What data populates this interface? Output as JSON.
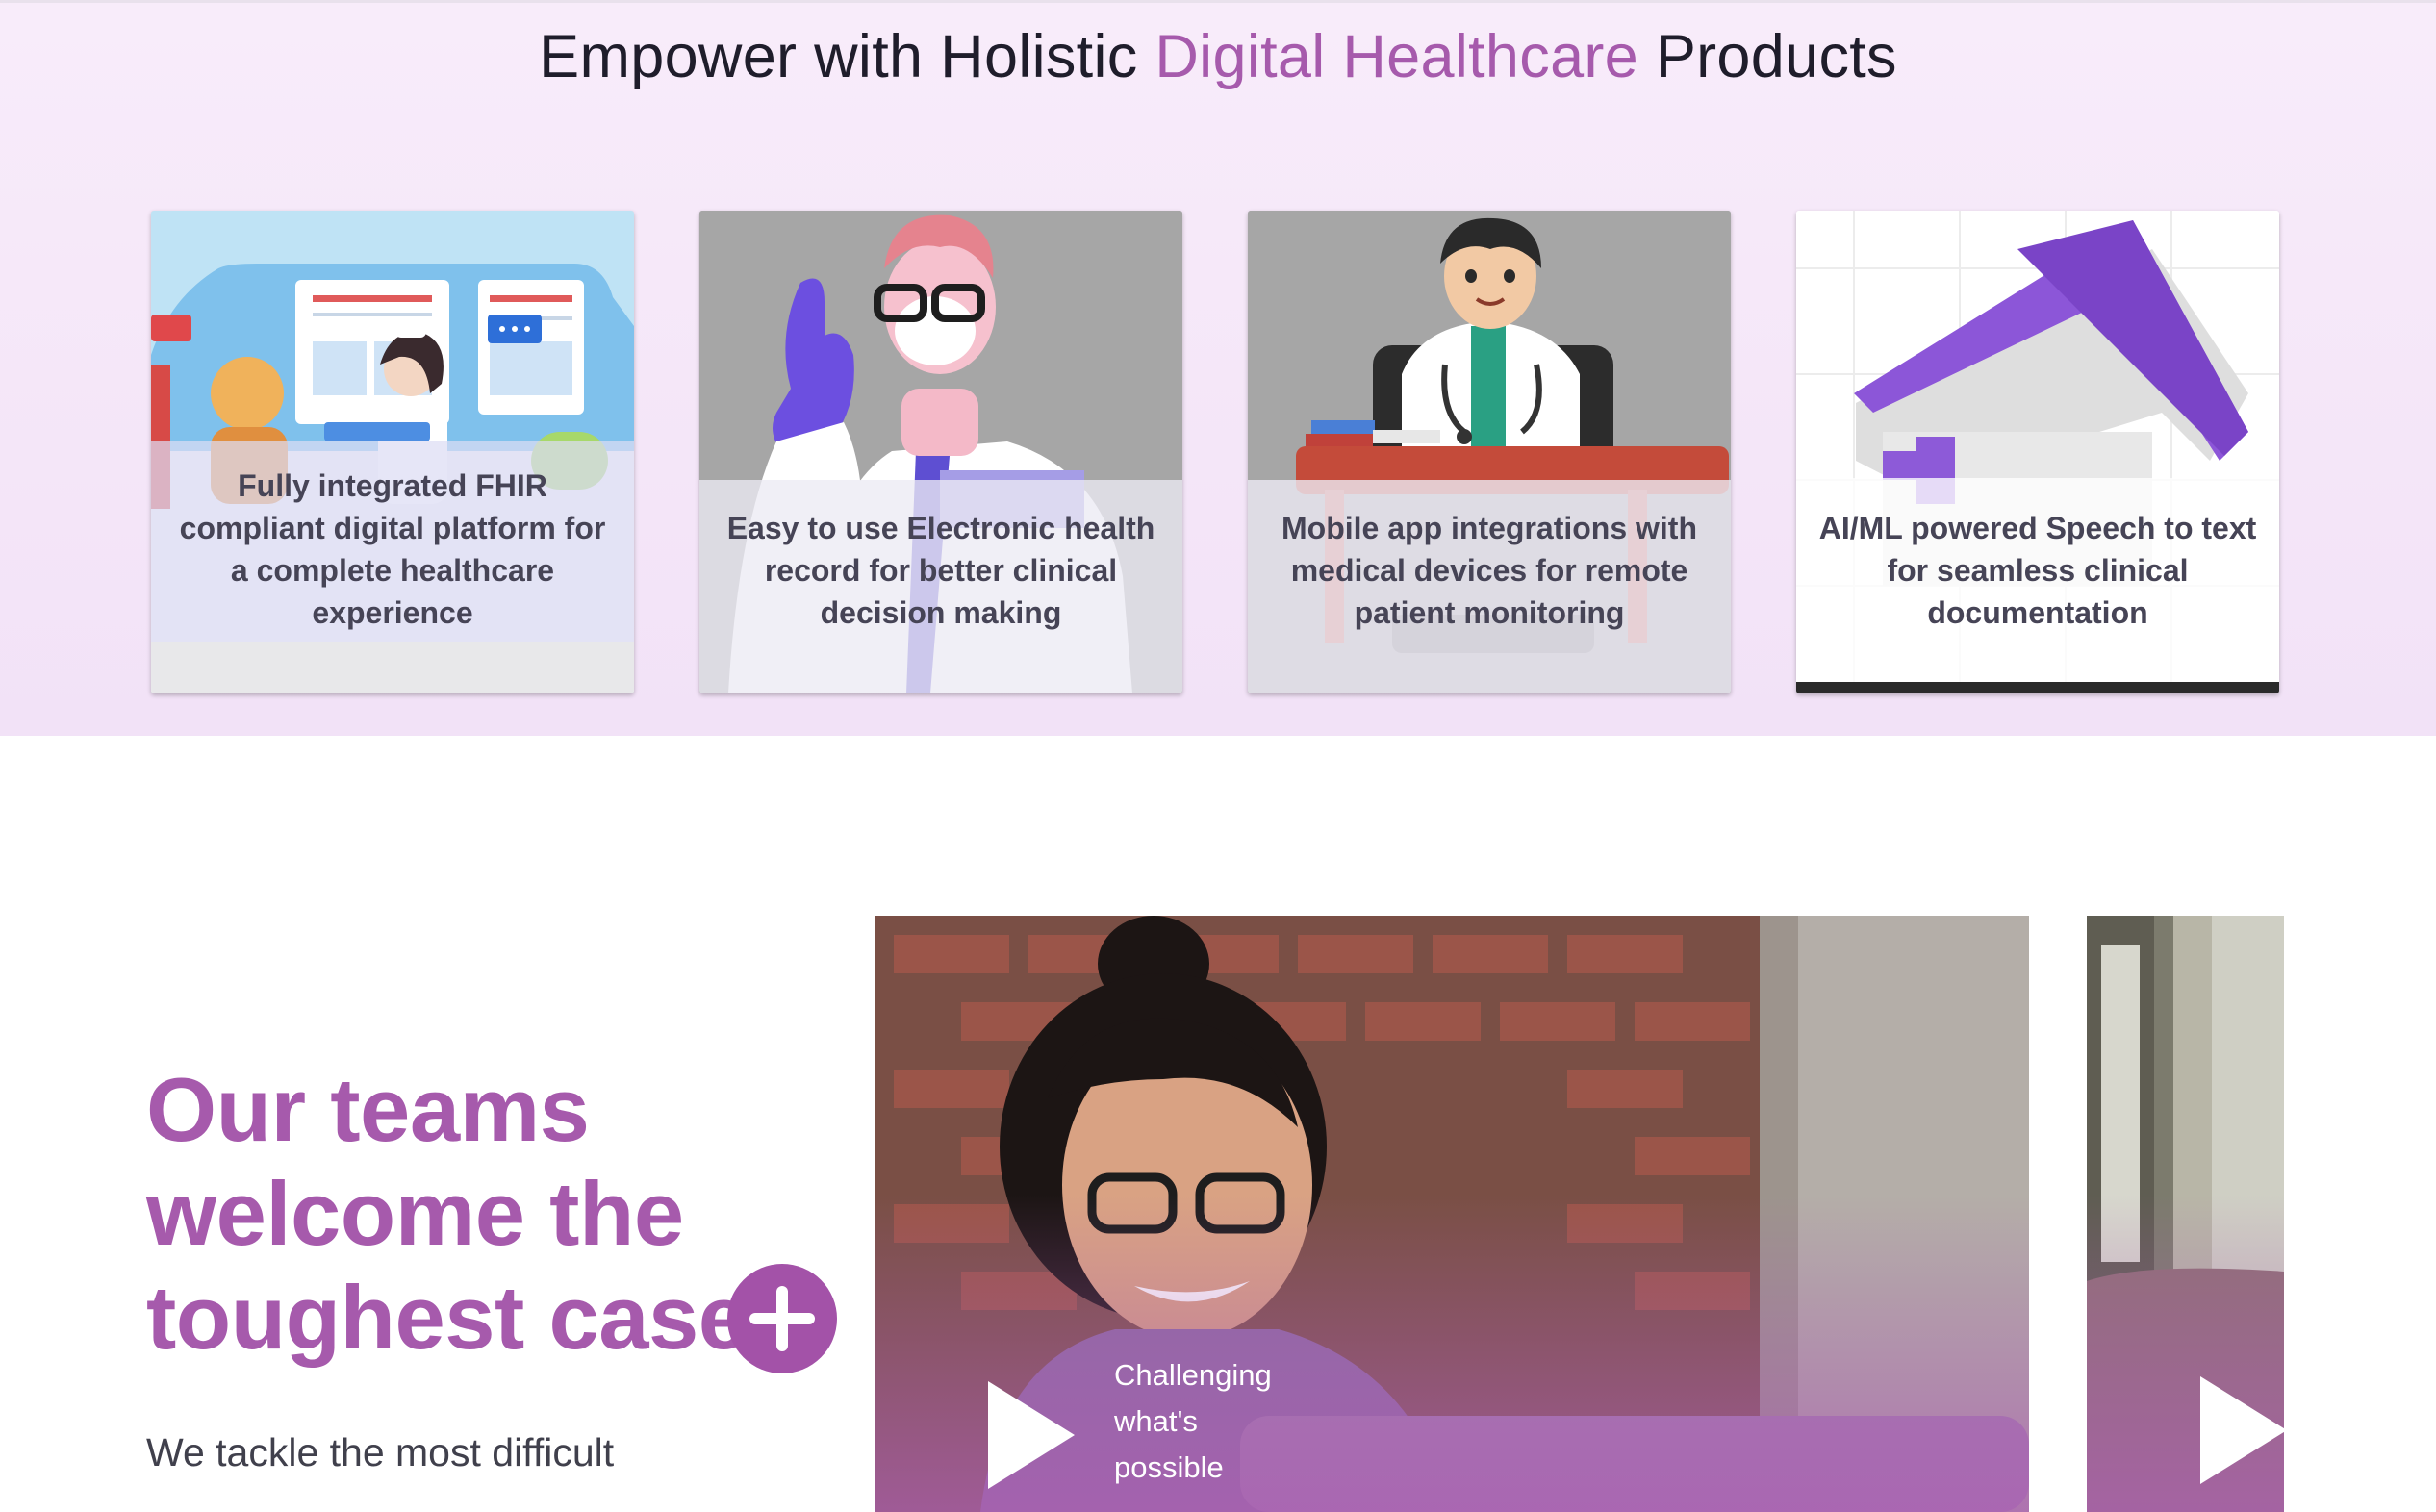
{
  "products": {
    "title_prefix": "Empower with Holistic ",
    "title_accent": "Digital Healthcare",
    "title_suffix": " Products",
    "accent_color": "#a65aac",
    "cards": [
      {
        "caption": "Fully integrated FHIR compliant digital platform for a complete healthcare experience"
      },
      {
        "caption": "Easy to use Electronic health record for better clinical decision making"
      },
      {
        "caption": "Mobile app integrations with medical devices for remote patient monitoring"
      },
      {
        "caption": "AI/ML powered Speech to text for seamless clinical documentation"
      }
    ]
  },
  "teams": {
    "heading_line1": "Our teams",
    "heading_line2": "welcome the",
    "heading_line3": "toughest case",
    "body": "We tackle the most difficult",
    "plus_icon": "plus-icon",
    "brand_color": "#a352a8"
  },
  "videos": [
    {
      "caption_line1": "Challenging",
      "caption_line2": "what's",
      "caption_line3": "possible",
      "icon": "play-icon"
    },
    {
      "icon": "play-icon"
    }
  ]
}
